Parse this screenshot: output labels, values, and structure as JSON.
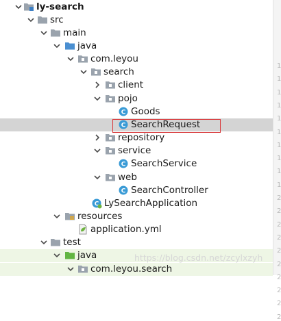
{
  "tree": {
    "rows": [
      {
        "label": "ly-search",
        "icon": "module-folder-icon",
        "bold": true
      },
      {
        "label": "src",
        "icon": "folder-icon"
      },
      {
        "label": "main",
        "icon": "folder-icon"
      },
      {
        "label": "java",
        "icon": "source-folder-icon"
      },
      {
        "label": "com.leyou",
        "icon": "package-icon"
      },
      {
        "label": "search",
        "icon": "package-icon"
      },
      {
        "label": "client",
        "icon": "package-icon"
      },
      {
        "label": "pojo",
        "icon": "package-icon"
      },
      {
        "label": "Goods",
        "icon": "class-icon"
      },
      {
        "label": "SearchRequest",
        "icon": "class-icon",
        "selected": true
      },
      {
        "label": "repository",
        "icon": "package-icon"
      },
      {
        "label": "service",
        "icon": "package-icon"
      },
      {
        "label": "SearchService",
        "icon": "class-icon"
      },
      {
        "label": "web",
        "icon": "package-icon"
      },
      {
        "label": "SearchController",
        "icon": "class-icon"
      },
      {
        "label": "LySearchApplication",
        "icon": "spring-boot-class-icon"
      },
      {
        "label": "resources",
        "icon": "resources-folder-icon"
      },
      {
        "label": "application.yml",
        "icon": "spring-config-file-icon"
      },
      {
        "label": "test",
        "icon": "folder-icon"
      },
      {
        "label": "java",
        "icon": "test-source-folder-icon"
      },
      {
        "label": "com.leyou.search",
        "icon": "package-icon"
      }
    ]
  },
  "colors": {
    "selection": "#d4d4d4",
    "highlight_box": "#d9383a",
    "class_icon": "#3a9bd6",
    "source_folder": "#4a8fd1",
    "test_folder": "#62b543",
    "folder": "#9aa3ad",
    "test_row_bg": "#eef6e5"
  },
  "gutter_numbers": [
    "1",
    "1",
    "1",
    "1",
    "1",
    "1",
    "1",
    "1",
    "1",
    "1",
    "2",
    "2",
    "2",
    "2",
    "2",
    "2",
    "2",
    "2",
    "2",
    "2"
  ],
  "watermark": "https://blog.csdn.net/zcylxzyh"
}
